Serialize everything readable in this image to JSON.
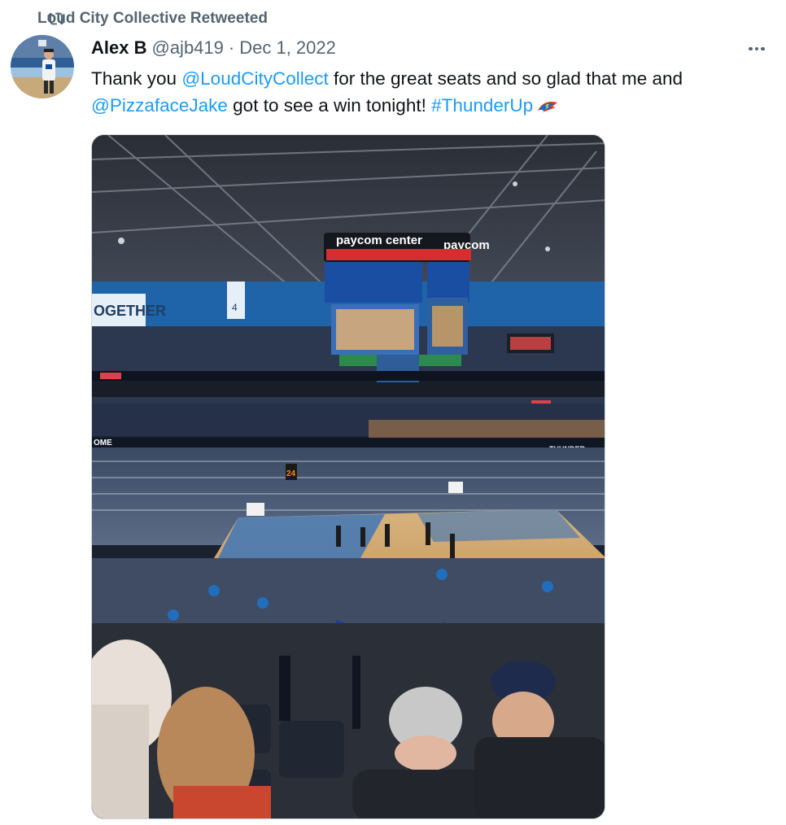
{
  "retweet": {
    "label": "Loud City Collective Retweeted",
    "icon": "retweet-icon"
  },
  "tweet": {
    "author_name": "Alex B",
    "author_handle": "@ajb419",
    "separator": "·",
    "date": "Dec 1, 2022",
    "text_parts": {
      "t1": "Thank you ",
      "mention1": "@LoudCityCollect",
      "t2": " for the great seats and so glad that me and ",
      "mention2": "@PizzafaceJake",
      "t3": " got to see a win tonight! ",
      "hashtag": "#ThunderUp"
    },
    "emoji_icon": "thunder-hashflag-icon",
    "more_icon": "more-options-icon"
  },
  "media": {
    "arena_signage": {
      "scoreboard_brand": "paycom center",
      "scoreboard_brand_2": "paycom",
      "banner_left": "OGETHER",
      "retired_number": "4",
      "shot_clock": "24",
      "baseline_left": "OME",
      "baseline_right": "THUNDER"
    }
  },
  "colors": {
    "link": "#1d9bf0",
    "secondary_text": "#536471",
    "primary_text": "#0f1419"
  }
}
